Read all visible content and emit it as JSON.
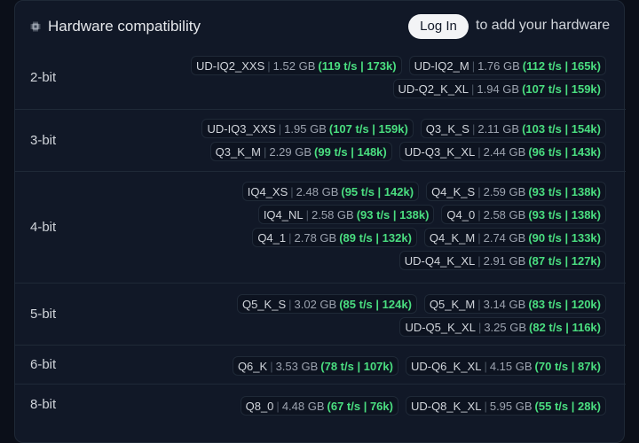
{
  "header": {
    "title": "Hardware compatibility",
    "login_label": "Log In",
    "login_suffix": "to add your hardware"
  },
  "colors": {
    "speed": "#4ade80",
    "panel_bg": "#111827",
    "page_bg": "#0b0f19",
    "button_bg": "#f3f4f6"
  },
  "groups": [
    {
      "label": "2-bit",
      "quants": [
        {
          "name": "UD-IQ2_XXS",
          "size": "1.52 GB",
          "speed": "(119 t/s | 173k)"
        },
        {
          "name": "UD-IQ2_M",
          "size": "1.76 GB",
          "speed": "(112 t/s | 165k)"
        },
        {
          "name": "UD-Q2_K_XL",
          "size": "1.94 GB",
          "speed": "(107 t/s | 159k)"
        }
      ]
    },
    {
      "label": "3-bit",
      "quants": [
        {
          "name": "UD-IQ3_XXS",
          "size": "1.95 GB",
          "speed": "(107 t/s | 159k)"
        },
        {
          "name": "Q3_K_S",
          "size": "2.11 GB",
          "speed": "(103 t/s | 154k)"
        },
        {
          "name": "Q3_K_M",
          "size": "2.29 GB",
          "speed": "(99 t/s | 148k)"
        },
        {
          "name": "UD-Q3_K_XL",
          "size": "2.44 GB",
          "speed": "(96 t/s | 143k)"
        }
      ]
    },
    {
      "label": "4-bit",
      "quants": [
        {
          "name": "IQ4_XS",
          "size": "2.48 GB",
          "speed": "(95 t/s | 142k)"
        },
        {
          "name": "Q4_K_S",
          "size": "2.59 GB",
          "speed": "(93 t/s | 138k)"
        },
        {
          "name": "IQ4_NL",
          "size": "2.58 GB",
          "speed": "(93 t/s | 138k)"
        },
        {
          "name": "Q4_0",
          "size": "2.58 GB",
          "speed": "(93 t/s | 138k)"
        },
        {
          "name": "Q4_1",
          "size": "2.78 GB",
          "speed": "(89 t/s | 132k)"
        },
        {
          "name": "Q4_K_M",
          "size": "2.74 GB",
          "speed": "(90 t/s | 133k)"
        },
        {
          "name": "UD-Q4_K_XL",
          "size": "2.91 GB",
          "speed": "(87 t/s | 127k)"
        }
      ]
    },
    {
      "label": "5-bit",
      "quants": [
        {
          "name": "Q5_K_S",
          "size": "3.02 GB",
          "speed": "(85 t/s | 124k)"
        },
        {
          "name": "Q5_K_M",
          "size": "3.14 GB",
          "speed": "(83 t/s | 120k)"
        },
        {
          "name": "UD-Q5_K_XL",
          "size": "3.25 GB",
          "speed": "(82 t/s | 116k)"
        }
      ]
    },
    {
      "label": "6-bit",
      "quants": [
        {
          "name": "Q6_K",
          "size": "3.53 GB",
          "speed": "(78 t/s | 107k)"
        },
        {
          "name": "UD-Q6_K_XL",
          "size": "4.15 GB",
          "speed": "(70 t/s | 87k)"
        }
      ]
    },
    {
      "label": "8-bit",
      "quants": [
        {
          "name": "Q8_0",
          "size": "4.48 GB",
          "speed": "(67 t/s | 76k)"
        },
        {
          "name": "UD-Q8_K_XL",
          "size": "5.95 GB",
          "speed": "(55 t/s | 28k)"
        }
      ]
    }
  ]
}
